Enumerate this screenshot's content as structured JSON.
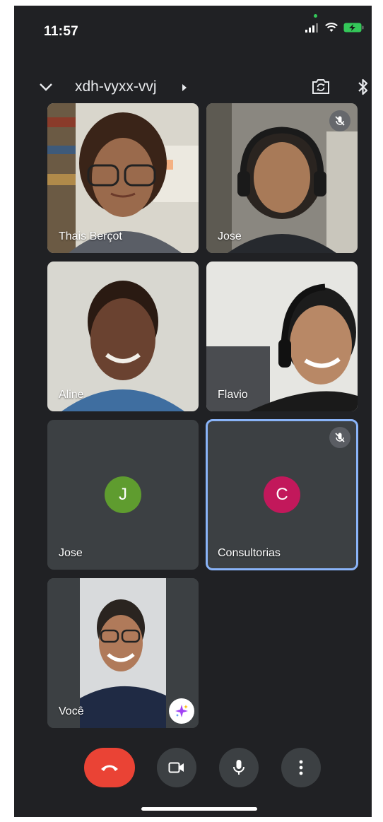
{
  "status_bar": {
    "time": "11:57",
    "battery_color": "#34c759"
  },
  "header": {
    "collapse_icon": "chevron-down-icon",
    "meeting_code": "xdh-vyxx-vvj",
    "switch_camera_icon": "camera-switch-icon",
    "audio_device_icon": "bluetooth-icon"
  },
  "participants": [
    {
      "name": "Thais Berçot",
      "video": true,
      "muted": false
    },
    {
      "name": "Jose",
      "video": true,
      "muted": true
    },
    {
      "name": "Aline",
      "video": true,
      "muted": false
    },
    {
      "name": "Flavio",
      "video": true,
      "muted": false
    },
    {
      "name": "Jose",
      "video": false,
      "initial": "J",
      "avatar_color": "#5f9c2f",
      "muted": false
    },
    {
      "name": "Consultorias",
      "video": false,
      "initial": "C",
      "avatar_color": "#c2185b",
      "muted": true,
      "active_speaker": true
    },
    {
      "name": "Você",
      "video": true,
      "self": true,
      "effects_icon": "sparkle-effects-icon"
    }
  ],
  "controls": {
    "end_call_color": "#ea4335",
    "items": [
      "end-call-icon",
      "video-camera-icon",
      "microphone-icon",
      "more-vert-icon"
    ]
  }
}
